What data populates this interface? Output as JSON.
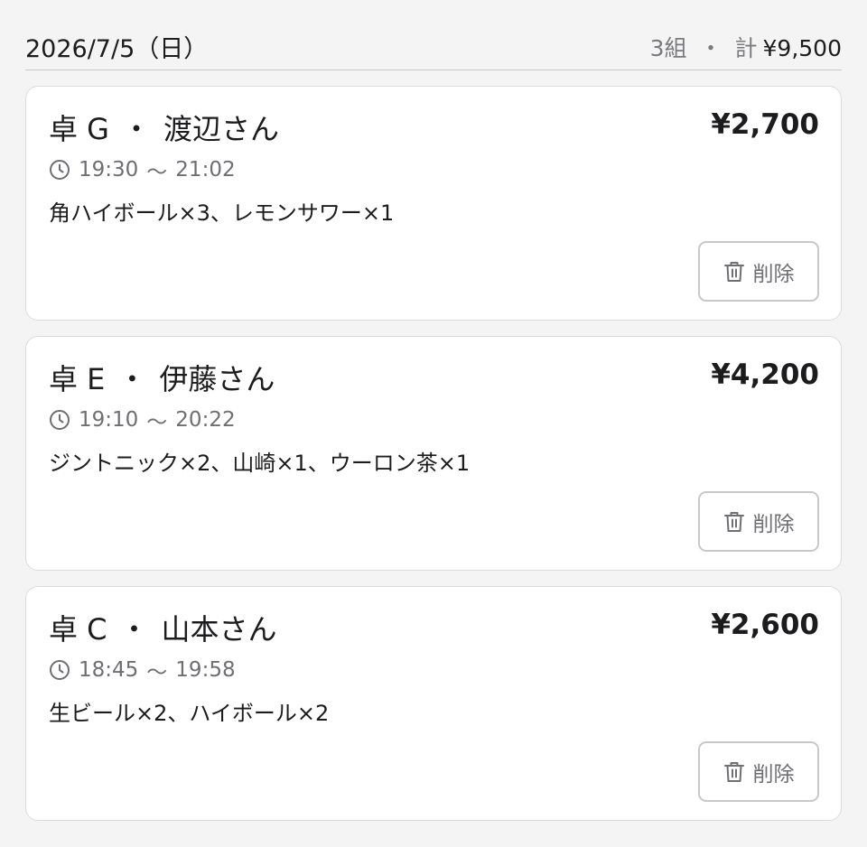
{
  "header": {
    "date": "2026/7/5（日）",
    "groups": "3組",
    "separator": "・",
    "total_label": "計",
    "total_amount": "¥9,500"
  },
  "orders": [
    {
      "table": "卓 G",
      "separator": "・",
      "customer": "渡辺さん",
      "amount": "¥2,700",
      "start_time": "19:30",
      "tilde": "〜",
      "end_time": "21:02",
      "items": "角ハイボール×3、レモンサワー×1",
      "delete_label": "削除",
      "icons": {
        "time": "clock-icon",
        "delete": "trash-icon"
      }
    },
    {
      "table": "卓 E",
      "separator": "・",
      "customer": "伊藤さん",
      "amount": "¥4,200",
      "start_time": "19:10",
      "tilde": "〜",
      "end_time": "20:22",
      "items": "ジントニック×2、山崎×1、ウーロン茶×1",
      "delete_label": "削除",
      "icons": {
        "time": "clock-icon",
        "delete": "trash-icon"
      }
    },
    {
      "table": "卓 C",
      "separator": "・",
      "customer": "山本さん",
      "amount": "¥2,600",
      "start_time": "18:45",
      "tilde": "〜",
      "end_time": "19:58",
      "items": "生ビール×2、ハイボール×2",
      "delete_label": "削除",
      "icons": {
        "time": "clock-icon",
        "delete": "trash-icon"
      }
    }
  ],
  "colors": {
    "background": "#f4f4f4",
    "card": "#ffffff",
    "text_primary": "#1c1c1e",
    "text_secondary": "#6e6e73",
    "border": "#c7c7cc"
  }
}
